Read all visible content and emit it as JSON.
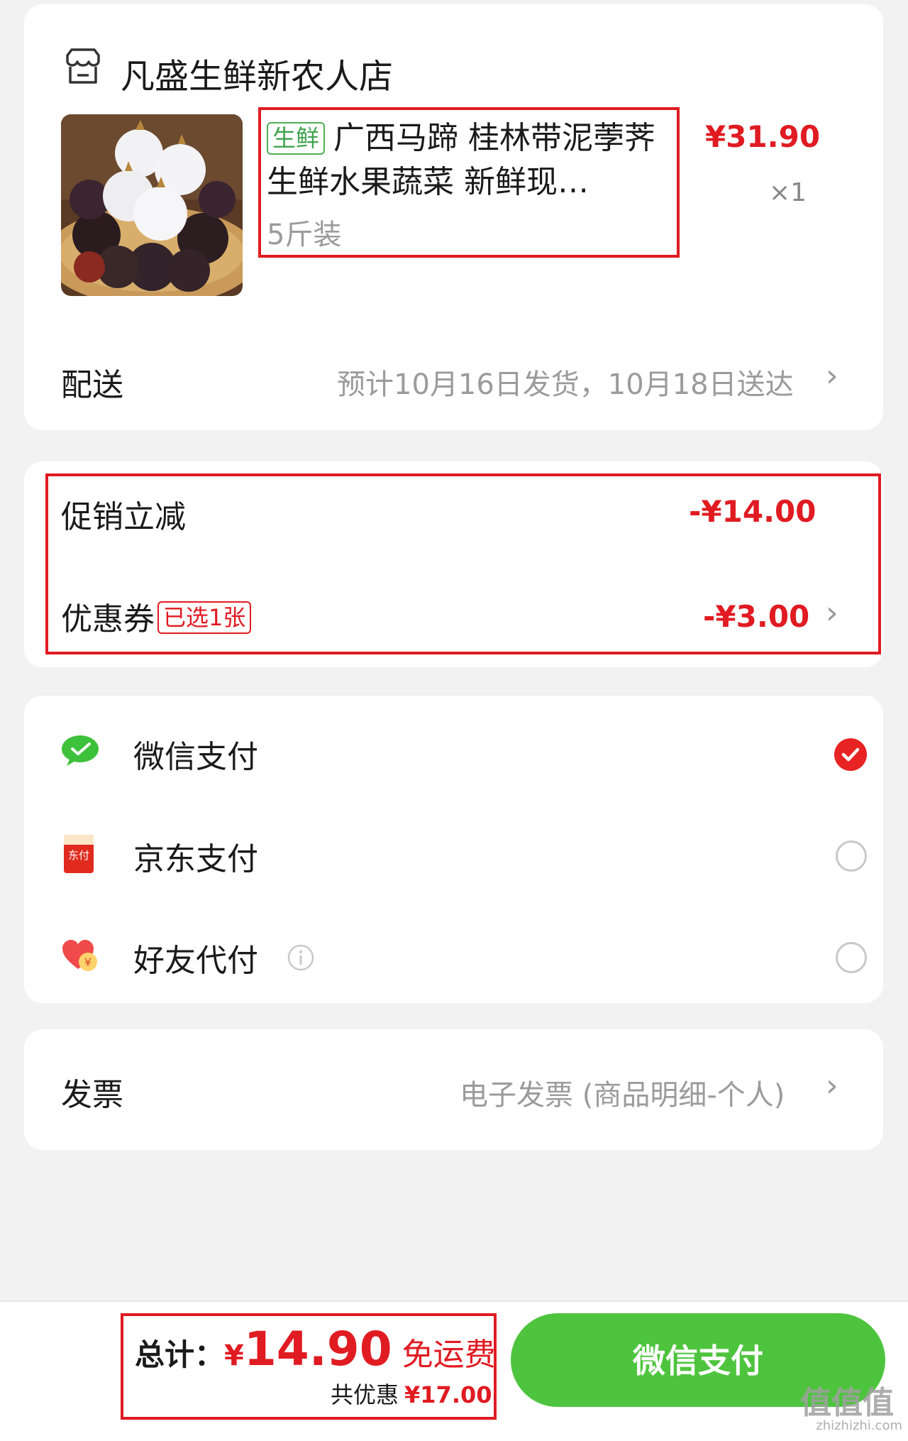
{
  "shop": {
    "name": "凡盛生鲜新农人店",
    "icon": "store-icon"
  },
  "product": {
    "tag": "生鲜",
    "title": "广西马蹄 桂林带泥荸荠生鲜水果蔬菜 新鲜现…",
    "price": "¥31.90",
    "quantity": "×1",
    "spec": "5斤装",
    "image": "water-chestnut-photo"
  },
  "delivery": {
    "label": "配送",
    "value": "预计10月16日发货，10月18日送达"
  },
  "promo": {
    "label": "促销立减",
    "amount": "-¥14.00"
  },
  "coupon": {
    "label": "优惠券",
    "tag": "已选1张",
    "amount": "-¥3.00"
  },
  "payment": {
    "options": [
      {
        "label": "微信支付",
        "icon": "wechat-pay-icon",
        "selected": true
      },
      {
        "label": "京东支付",
        "icon": "jd-pay-icon",
        "icon_text": "东付",
        "selected": false
      },
      {
        "label": "好友代付",
        "icon": "friend-pay-icon",
        "selected": false
      }
    ]
  },
  "invoice": {
    "label": "发票",
    "value": "电子发票 (商品明细-个人)"
  },
  "footer": {
    "total_label": "总计：",
    "currency": "¥",
    "total_amount": "14.90",
    "free_shipping": "免运费",
    "saving_label": "共优惠",
    "saving_amount": "¥17.00",
    "pay_button": "微信支付"
  },
  "watermark": {
    "text": "值值值",
    "sub": "zhizhizhi.com"
  },
  "colors": {
    "accent_red": "#e01b22",
    "wechat_green": "#4ec43e",
    "highlight_box": "#e01b22"
  }
}
